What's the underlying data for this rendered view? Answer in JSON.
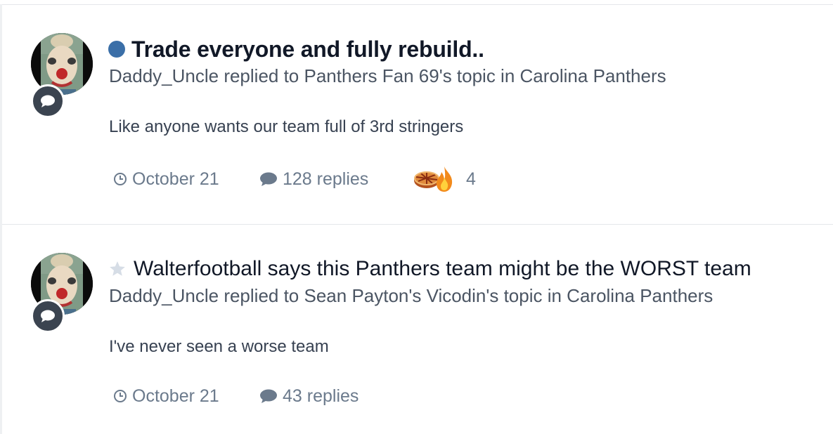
{
  "activity": [
    {
      "title": "Trade everyone and fully rebuild..",
      "title_bold": true,
      "status_icon": "unread-dot",
      "meta": "Daddy_Uncle replied to Panthers Fan 69's topic in Carolina Panthers",
      "snippet": "Like anyone wants our team full of 3rd stringers",
      "date": "October 21",
      "replies": "128 replies",
      "reactions": [
        "pie-icon",
        "fire-icon"
      ],
      "reaction_count": "4"
    },
    {
      "title": "Walterfootball says this Panthers team might be the WORST team",
      "title_bold": false,
      "status_icon": "star-icon",
      "meta": "Daddy_Uncle replied to Sean Payton's Vicodin's topic in Carolina Panthers",
      "snippet": "I've never seen a worse team",
      "date": "October 21",
      "replies": "43 replies"
    }
  ],
  "colors": {
    "unread_dot": "#3b6fa8",
    "badge_bg": "#3b4450",
    "meta_text": "#6b7a8c",
    "divider": "#e5e7eb"
  }
}
